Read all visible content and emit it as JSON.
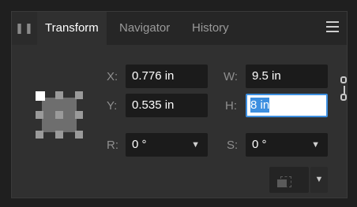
{
  "tabs": {
    "grip_icon": "grip-icon",
    "items": [
      {
        "label": "Transform",
        "active": true
      },
      {
        "label": "Navigator",
        "active": false
      },
      {
        "label": "History",
        "active": false
      }
    ],
    "menu_icon": "hamburger-icon"
  },
  "transform": {
    "x": {
      "label": "X:",
      "value": "0.776 in"
    },
    "y": {
      "label": "Y:",
      "value": "0.535 in"
    },
    "w": {
      "label": "W:",
      "value": "9.5 in"
    },
    "h": {
      "label": "H:",
      "value": "8 in"
    },
    "r": {
      "label": "R:",
      "value": "0 °"
    },
    "s": {
      "label": "S:",
      "value": "0 °"
    }
  },
  "colors": {
    "panel": "#303030",
    "field": "#1b1b1b",
    "accent": "#3d8fe0"
  }
}
